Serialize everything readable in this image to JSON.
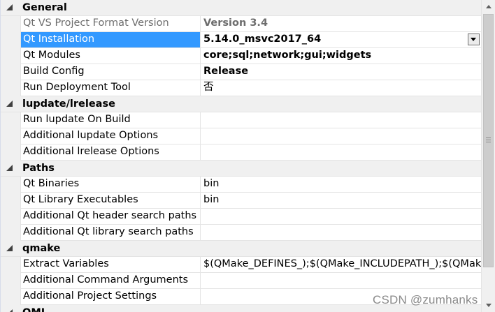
{
  "categories": [
    {
      "title": "General",
      "properties": [
        {
          "name": "Qt VS Project Format Version",
          "value": "Version 3.4"
        },
        {
          "name": "Qt Installation",
          "value": "5.14.0_msvc2017_64"
        },
        {
          "name": "Qt Modules",
          "value": "core;sql;network;gui;widgets"
        },
        {
          "name": "Build Config",
          "value": "Release"
        },
        {
          "name": "Run Deployment Tool",
          "value": "否"
        }
      ]
    },
    {
      "title": "lupdate/lrelease",
      "properties": [
        {
          "name": "Run lupdate On Build",
          "value": ""
        },
        {
          "name": "Additional lupdate Options",
          "value": ""
        },
        {
          "name": "Additional lrelease Options",
          "value": ""
        }
      ]
    },
    {
      "title": "Paths",
      "properties": [
        {
          "name": "Qt Binaries",
          "value": "bin"
        },
        {
          "name": "Qt Library Executables",
          "value": "bin"
        },
        {
          "name": "Additional Qt header search paths",
          "value": ""
        },
        {
          "name": "Additional Qt library search paths",
          "value": ""
        }
      ]
    },
    {
      "title": "qmake",
      "properties": [
        {
          "name": "Extract Variables",
          "value": "$(QMake_DEFINES_);$(QMake_INCLUDEPATH_);$(QMake_LIBS_)"
        },
        {
          "name": "Additional Command Arguments",
          "value": ""
        },
        {
          "name": "Additional Project Settings",
          "value": ""
        }
      ]
    },
    {
      "title": "QML",
      "properties": []
    }
  ],
  "watermark": "CSDN @zumhanks",
  "colors": {
    "selection": "#3399ff",
    "category_background": "#f0f0f0",
    "grid_lines": "#e4e4e4",
    "readonly_text": "#6d6d6d"
  }
}
